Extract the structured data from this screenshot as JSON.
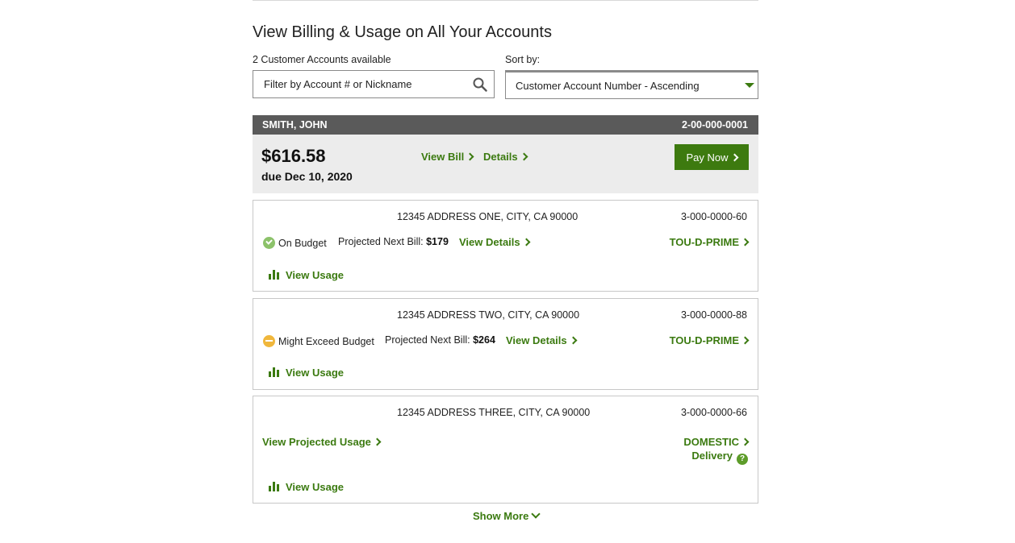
{
  "page": {
    "title": "View Billing & Usage on All Your Accounts",
    "accounts_available": "2 Customer Accounts available",
    "sort_label": "Sort by:",
    "filter_placeholder": "Filter by Account # or Nickname",
    "sort_value": "Customer Account Number - Ascending",
    "show_more": "Show More"
  },
  "account": {
    "name": "SMITH, JOHN",
    "number": "2-00-000-0001",
    "amount": "$616.58",
    "due": "due Dec 10, 2020",
    "view_bill": "View Bill",
    "details": "Details",
    "pay_now": "Pay Now"
  },
  "service_agreements": [
    {
      "address": "12345 ADDRESS ONE, CITY, CA 90000",
      "number": "3-000-0000-60",
      "status": "On Budget",
      "status_icon": "check-circle-icon",
      "projected_label": "Projected Next Bill:",
      "projected_value": "$179",
      "view_details": "View Details",
      "rate": "TOU-D-PRIME",
      "view_usage": "View Usage"
    },
    {
      "address": "12345 ADDRESS TWO, CITY, CA 90000",
      "number": "3-000-0000-88",
      "status": "Might Exceed Budget",
      "status_icon": "minus-circle-icon",
      "projected_label": "Projected Next Bill:",
      "projected_value": "$264",
      "view_details": "View Details",
      "rate": "TOU-D-PRIME",
      "view_usage": "View Usage"
    },
    {
      "address": "12345 ADDRESS THREE, CITY, CA 90000",
      "number": "3-000-0000-66",
      "view_projected_usage": "View Projected Usage",
      "rate": "DOMESTIC",
      "rate_sub": "Delivery",
      "help": "?",
      "view_usage": "View Usage"
    }
  ],
  "colors": {
    "accent_green": "#3b7a10",
    "button_green": "#3d7a0f",
    "header_bar": "#5a5a5a",
    "summary_bg": "#ececec",
    "ok_status": "#8cc26a",
    "warn_status": "#f0b73c"
  }
}
